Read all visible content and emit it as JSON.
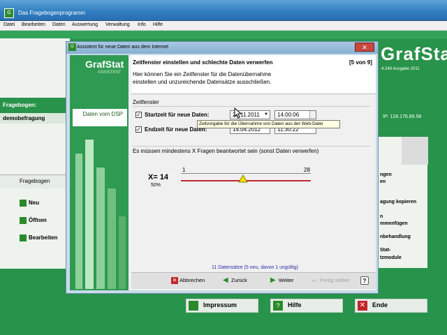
{
  "main_window": {
    "title": "Das Fragebogenprogramm",
    "menu": [
      "Datei",
      "Bearbeiten",
      "Daten",
      "Auswertung",
      "Verwaltung",
      "Info",
      "Hilfe"
    ],
    "logo": "GrafStat",
    "version": "4.249 Ausgabe 2011",
    "ip": "IP: 128.176.89.58"
  },
  "left_panel": {
    "fragebogen_label": "Fragebogen:",
    "fragebogen_value": "demobefragung",
    "tab_label": "Fragebogen",
    "buttons": [
      "Neu",
      "Öffnen",
      "Bearbeiten"
    ]
  },
  "right_panel": {
    "items": [
      "ngen",
      "en",
      "agung kopieren",
      "n",
      "mmenfügen",
      "nbehandlung",
      "Stat-",
      "tzmodule"
    ]
  },
  "bottom_buttons": {
    "impressum": "Impressum",
    "hilfe": "Hilfe",
    "ende": "Ende"
  },
  "dialog": {
    "title": "Assistent für neue Daten aus dem Internet",
    "close": "✕",
    "side_logo": "GrafStat",
    "side_subtitle": "ASSISTENT",
    "side_label": "Daten vom DSP",
    "heading": "Zeitfenster einstellen und schlechte Daten verwerfen",
    "step": "[5 von 9]",
    "intro": "Hier können Sie ein Zeitfenster für die Datenübernahme einstellen und unzureichende Datensätze ausschließen.",
    "zeitfenster": {
      "label": "Zeitfenster",
      "start": {
        "checked": true,
        "label": "Startzeit für neue Daten:",
        "date": "23.11.2011",
        "time": "14:00:06"
      },
      "end": {
        "checked": true,
        "label": "Endzeit für neue Daten:",
        "date": "14.04.2012",
        "time": "11:30:22"
      },
      "tooltip": "Zeitvorgabe für die Übernahme von Daten aus der Web-Datei"
    },
    "min_fragen": {
      "label": "Es müssen mindestens X Fragen beantwortet sein (sonst Daten verwerfen)",
      "x_value": "X= 14",
      "percent": "50%",
      "slider_min": "1",
      "slider_max": "28",
      "slider_value": 14
    },
    "status": "11 Datensätze (5 neu, davon 1 ungültig)",
    "footer": {
      "abbrechen": "Abbrechen",
      "zurueck": "Zurück",
      "weiter": "Weiter",
      "fertig": "Fertig stellen",
      "help": "?"
    }
  },
  "colors": {
    "main_green": "#28934a",
    "slider_red": "#c0262c",
    "thumb_yellow": "#f2e600"
  }
}
